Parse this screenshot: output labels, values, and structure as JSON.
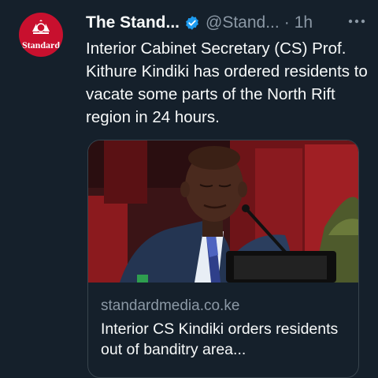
{
  "account": {
    "avatar_text": "Standard",
    "name": "The Stand...",
    "handle": "@Stand...",
    "separator": "·",
    "time": "1h",
    "verified_icon": "verified-badge-icon",
    "more_icon": "more-options-icon"
  },
  "tweet": {
    "text": "Interior Cabinet Secretary (CS) Prof. Kithure Kindiki has ordered residents to vacate some parts of the North Rift region in 24 hours."
  },
  "card": {
    "domain": "standardmedia.co.ke",
    "title": "Interior CS Kindiki orders residents out of banditry area..."
  },
  "colors": {
    "background": "#15202b",
    "text_primary": "#f7f9f9",
    "text_secondary": "#8b98a5",
    "verified_blue": "#1d9bf0",
    "brand_red": "#c8102e",
    "card_border": "#38444d"
  }
}
